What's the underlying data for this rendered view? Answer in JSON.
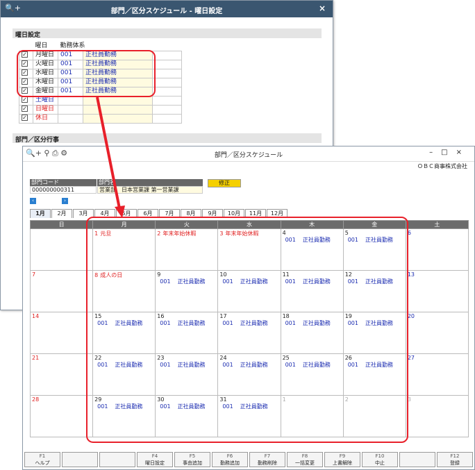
{
  "win1": {
    "title": "部門／区分スケジュール - 曜日設定",
    "close": "×",
    "section1": "曜日設定",
    "col_day": "曜日",
    "col_work": "勤務体系",
    "section2": "部門／区分行事",
    "rows": [
      {
        "day": "月曜日",
        "code": "001",
        "name": "正社員勤務"
      },
      {
        "day": "火曜日",
        "code": "001",
        "name": "正社員勤務"
      },
      {
        "day": "水曜日",
        "code": "001",
        "name": "正社員勤務"
      },
      {
        "day": "木曜日",
        "code": "001",
        "name": "正社員勤務"
      },
      {
        "day": "金曜日",
        "code": "001",
        "name": "正社員勤務"
      },
      {
        "day": "土曜日",
        "code": "",
        "name": ""
      },
      {
        "day": "日曜日",
        "code": "",
        "name": ""
      },
      {
        "day": "休日",
        "code": "",
        "name": ""
      }
    ]
  },
  "win2": {
    "title": "部門／区分スケジュール",
    "company": "ＯＢＣ商事株式会社",
    "dept_code_label": "部門コード",
    "dept_name_label": "部門名",
    "dept_code": "000000000311",
    "dept_name": "営業部　日本営業課 第一営業課",
    "mode": "修正",
    "months": [
      "1月",
      "2月",
      "3月",
      "4月",
      "5月",
      "6月",
      "7月",
      "8月",
      "9月",
      "10月",
      "11月",
      "12月"
    ],
    "weekdays": [
      "日",
      "月",
      "火",
      "水",
      "木",
      "金",
      "土"
    ],
    "weeks": [
      [
        {
          "d": "",
          "h": ""
        },
        {
          "d": "1",
          "h": "元旦"
        },
        {
          "d": "2",
          "h": "年末年始休暇"
        },
        {
          "d": "3",
          "h": "年末年始休暇"
        },
        {
          "d": "4",
          "code": "001",
          "work": "正社員勤務"
        },
        {
          "d": "5",
          "code": "001",
          "work": "正社員勤務"
        },
        {
          "d": "6"
        }
      ],
      [
        {
          "d": "7"
        },
        {
          "d": "8",
          "h": "成人の日"
        },
        {
          "d": "9",
          "code": "001",
          "work": "正社員勤務"
        },
        {
          "d": "10",
          "code": "001",
          "work": "正社員勤務"
        },
        {
          "d": "11",
          "code": "001",
          "work": "正社員勤務"
        },
        {
          "d": "12",
          "code": "001",
          "work": "正社員勤務"
        },
        {
          "d": "13"
        }
      ],
      [
        {
          "d": "14"
        },
        {
          "d": "15",
          "code": "001",
          "work": "正社員勤務"
        },
        {
          "d": "16",
          "code": "001",
          "work": "正社員勤務"
        },
        {
          "d": "17",
          "code": "001",
          "work": "正社員勤務"
        },
        {
          "d": "18",
          "code": "001",
          "work": "正社員勤務"
        },
        {
          "d": "19",
          "code": "001",
          "work": "正社員勤務"
        },
        {
          "d": "20"
        }
      ],
      [
        {
          "d": "21"
        },
        {
          "d": "22",
          "code": "001",
          "work": "正社員勤務"
        },
        {
          "d": "23",
          "code": "001",
          "work": "正社員勤務"
        },
        {
          "d": "24",
          "code": "001",
          "work": "正社員勤務"
        },
        {
          "d": "25",
          "code": "001",
          "work": "正社員勤務"
        },
        {
          "d": "26",
          "code": "001",
          "work": "正社員勤務"
        },
        {
          "d": "27"
        }
      ],
      [
        {
          "d": "28"
        },
        {
          "d": "29",
          "code": "001",
          "work": "正社員勤務"
        },
        {
          "d": "30",
          "code": "001",
          "work": "正社員勤務"
        },
        {
          "d": "31",
          "code": "001",
          "work": "正社員勤務"
        },
        {
          "d": "1",
          "grey": true
        },
        {
          "d": "2",
          "grey": true
        },
        {
          "d": "3",
          "grey": true
        }
      ]
    ],
    "fkeys": [
      {
        "k": "F1",
        "l": "ヘルプ"
      },
      {
        "k": "",
        "l": ""
      },
      {
        "k": "",
        "l": ""
      },
      {
        "k": "F4",
        "l": "曜日設定"
      },
      {
        "k": "F5",
        "l": "事由追加"
      },
      {
        "k": "F6",
        "l": "勤務追加"
      },
      {
        "k": "F7",
        "l": "勤務削除"
      },
      {
        "k": "F8",
        "l": "一括変更"
      },
      {
        "k": "F9",
        "l": "上書解除"
      },
      {
        "k": "F10",
        "l": "中止"
      },
      {
        "k": "",
        "l": ""
      },
      {
        "k": "F12",
        "l": "登録"
      }
    ]
  },
  "colors": {
    "accent_red": "#e8202a",
    "title_bar": "#3a5670",
    "mode_yellow": "#f5d000"
  }
}
